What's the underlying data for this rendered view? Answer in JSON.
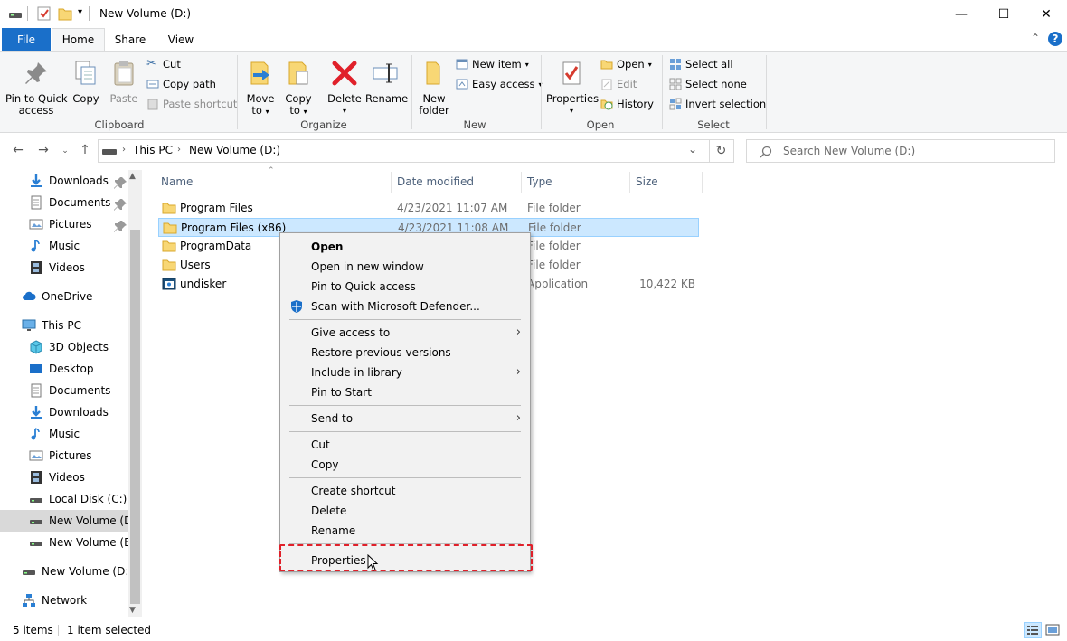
{
  "window": {
    "title": "New Volume (D:)",
    "minimize_glyph": "—",
    "maximize_glyph": "☐",
    "close_glyph": "✕"
  },
  "ribbon_tabs": {
    "file": "File",
    "home": "Home",
    "share": "Share",
    "view": "View"
  },
  "ribbon": {
    "clipboard": {
      "label": "Clipboard",
      "pin_line1": "Pin to Quick",
      "pin_line2": "access",
      "copy": "Copy",
      "paste": "Paste",
      "cut": "Cut",
      "copy_path": "Copy path",
      "paste_shortcut": "Paste shortcut"
    },
    "organize": {
      "label": "Organize",
      "move_line1": "Move",
      "move_line2": "to",
      "copy_line1": "Copy",
      "copy_line2": "to",
      "delete": "Delete",
      "rename": "Rename"
    },
    "new": {
      "label": "New",
      "folder_line1": "New",
      "folder_line2": "folder",
      "new_item": "New item",
      "easy_access": "Easy access"
    },
    "open": {
      "label": "Open",
      "properties": "Properties",
      "open": "Open",
      "edit": "Edit",
      "history": "History"
    },
    "select": {
      "label": "Select",
      "select_all": "Select all",
      "select_none": "Select none",
      "invert": "Invert selection"
    }
  },
  "address": {
    "path": [
      "This PC",
      "New Volume (D:)"
    ],
    "search_placeholder": "Search New Volume (D:)"
  },
  "nav_pane": {
    "items": [
      {
        "label": "Downloads",
        "icon": "download-arrow-icon",
        "pinned": true
      },
      {
        "label": "Documents",
        "icon": "document-icon",
        "pinned": true
      },
      {
        "label": "Pictures",
        "icon": "pictures-icon",
        "pinned": true
      },
      {
        "label": "Music",
        "icon": "music-note-icon",
        "pinned": false
      },
      {
        "label": "Videos",
        "icon": "film-icon",
        "pinned": false
      },
      {
        "label": "OneDrive",
        "icon": "cloud-icon",
        "pinned": false
      },
      {
        "label": "This PC",
        "icon": "monitor-icon",
        "pinned": false
      },
      {
        "label": "3D Objects",
        "icon": "cube-icon",
        "pinned": false
      },
      {
        "label": "Desktop",
        "icon": "desktop-icon",
        "pinned": false
      },
      {
        "label": "Documents",
        "icon": "document-icon",
        "pinned": false
      },
      {
        "label": "Downloads",
        "icon": "download-arrow-icon",
        "pinned": false
      },
      {
        "label": "Music",
        "icon": "music-note-icon",
        "pinned": false
      },
      {
        "label": "Pictures",
        "icon": "pictures-icon",
        "pinned": false
      },
      {
        "label": "Videos",
        "icon": "film-icon",
        "pinned": false
      },
      {
        "label": "Local Disk (C:)",
        "icon": "drive-icon",
        "pinned": false
      },
      {
        "label": "New Volume (D:)",
        "icon": "drive-icon",
        "pinned": false,
        "selected": true
      },
      {
        "label": "New Volume (E:)",
        "icon": "drive-icon",
        "pinned": false
      },
      {
        "label": "New Volume (D:)",
        "icon": "drive-icon",
        "pinned": false
      },
      {
        "label": "Network",
        "icon": "network-icon",
        "pinned": false
      }
    ]
  },
  "file_list": {
    "columns": [
      "Name",
      "Date modified",
      "Type",
      "Size"
    ],
    "rows": [
      {
        "name": "Program Files",
        "date": "4/23/2021 11:07 AM",
        "type": "File folder",
        "size": "",
        "icon": "folder-icon"
      },
      {
        "name": "Program Files (x86)",
        "date": "4/23/2021 11:08 AM",
        "type": "File folder",
        "size": "",
        "icon": "folder-icon",
        "selected": true
      },
      {
        "name": "ProgramData",
        "date": "",
        "type": "File folder",
        "size": "",
        "icon": "folder-icon"
      },
      {
        "name": "Users",
        "date": "",
        "type": "File folder",
        "size": "",
        "icon": "folder-icon"
      },
      {
        "name": "undisker",
        "date": "",
        "type": "Application",
        "size": "10,422 KB",
        "icon": "application-icon"
      }
    ]
  },
  "context_menu": {
    "items": [
      {
        "label": "Open",
        "bold": true
      },
      {
        "label": "Open in new window"
      },
      {
        "label": "Pin to Quick access"
      },
      {
        "label": "Scan with Microsoft Defender...",
        "icon": "defender-shield-icon"
      },
      {
        "separator": true
      },
      {
        "label": "Give access to",
        "submenu": true
      },
      {
        "label": "Restore previous versions"
      },
      {
        "label": "Include in library",
        "submenu": true
      },
      {
        "label": "Pin to Start"
      },
      {
        "separator": true
      },
      {
        "label": "Send to",
        "submenu": true
      },
      {
        "separator": true
      },
      {
        "label": "Cut"
      },
      {
        "label": "Copy"
      },
      {
        "separator": true
      },
      {
        "label": "Create shortcut"
      },
      {
        "label": "Delete"
      },
      {
        "label": "Rename"
      },
      {
        "separator": true
      },
      {
        "label": "Properties",
        "highlighted": true
      }
    ]
  },
  "status_bar": {
    "item_count": "5 items",
    "selection": "1 item selected"
  },
  "colors": {
    "accent": "#1a6fc9",
    "selection_bg": "#cce8ff",
    "selection_border": "#99d1ff",
    "highlight_dash": "#e0202a",
    "folder": "#f8d775"
  }
}
